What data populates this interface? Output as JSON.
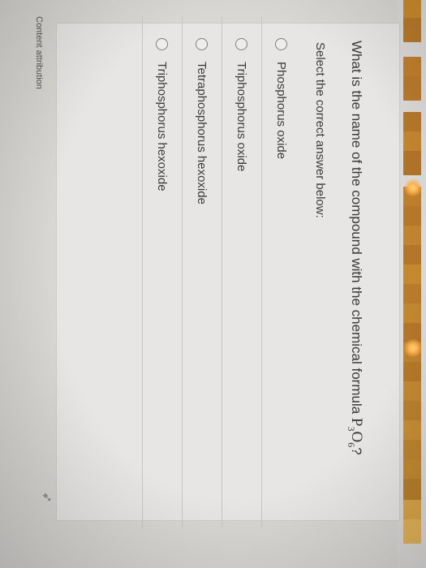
{
  "question": {
    "prefix": "What is the name of the compound with the chemical formula ",
    "formula_symbol_1": "P",
    "formula_sub_1": "3",
    "formula_symbol_2": "O",
    "formula_sub_2": "6",
    "suffix": "?"
  },
  "instructions": "Select the correct answer below:",
  "options": [
    "Phosphorus oxide",
    "Triphosphorus oxide",
    "Tetraphosphorus hexoxide",
    "Triphosphorus hexoxide"
  ],
  "attribution": "Content attribution",
  "colors": {
    "panel_background": "#e7e6e4",
    "text": "#3a3a3a",
    "radio_border": "#7f7f7f",
    "divider": "#c9c7c4"
  },
  "icons": {
    "cursor": "cursor-arrow-icon",
    "option_marker": "radio-empty-icon"
  }
}
